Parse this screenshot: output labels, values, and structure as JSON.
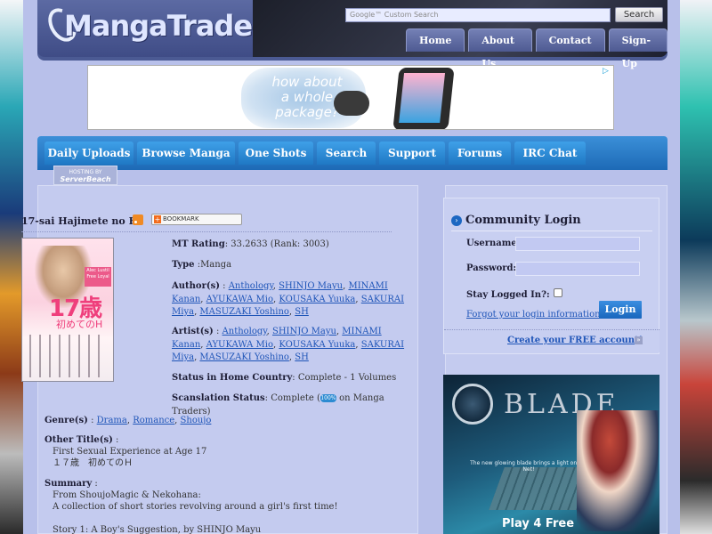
{
  "header": {
    "logo_text": "MangaTraders",
    "search_placeholder": "Google™ Custom Search",
    "search_button": "Search",
    "nav": [
      "Home",
      "About Us",
      "Contact",
      "Sign-Up"
    ]
  },
  "banner_ad": {
    "text": "how about a whole package?"
  },
  "main_nav": [
    "Daily Uploads",
    "Browse Manga",
    "One Shots",
    "Search",
    "Support",
    "Forums",
    "IRC Chat"
  ],
  "hosting_badge": {
    "line1": "HOSTING BY",
    "line2": "ServerBeach"
  },
  "manga": {
    "title": "17-sai Hajimete no H",
    "bookmark_label": "BOOKMARK",
    "cover": {
      "title": "17歳",
      "subtitle": "初めてのH",
      "tag": "Alec Lustil Free Loyal"
    },
    "rating_label": "MT Rating",
    "rating_value": ": 33.2633 (Rank: 3003)",
    "type_label": "Type",
    "type_value": ":Manga",
    "authors_label": "Author(s)",
    "artists_label": "Artist(s)",
    "people": [
      "Anthology",
      "SHINJO Mayu",
      "MINAMI Kanan",
      "AYUKAWA Mio",
      "KOUSAKA Yuuka",
      "SAKURAI Miya",
      "MASUZAKI Yoshino",
      "SH"
    ],
    "status_label": "Status in Home Country",
    "status_value": ": Complete - 1 Volumes",
    "scanlation_label": "Scanslation Status",
    "scanlation_prefix": ": Complete (",
    "scanlation_badge": "100%",
    "scanlation_suffix": " on Manga Traders)",
    "genres_label": "Genre(s)",
    "genres": [
      "Drama",
      "Romance",
      "Shoujo"
    ],
    "other_titles_label": "Other Title(s)",
    "other_titles": [
      "First Sexual Experience at Age 17",
      "１７歳　初めてのＨ"
    ],
    "summary_label": "Summary",
    "summary_lines": [
      "From ShoujoMagic & Nekohana:",
      "A collection of short stories revolving around a girl's first time!",
      "",
      "Story 1: A Boy's Suggestion, by SHINJO Mayu"
    ]
  },
  "login": {
    "title": "Community Login",
    "username_label": "Username:",
    "password_label": "Password:",
    "stay_logged_label": "Stay Logged In?:",
    "forgot_link": "Forgot your login information?",
    "login_button": "Login",
    "create_account": "Create your FREE account!"
  },
  "side_ad": {
    "title": "BLADE",
    "tagline": "The new glowing blade brings a light on the Net!",
    "cta": "Play 4 Free"
  }
}
